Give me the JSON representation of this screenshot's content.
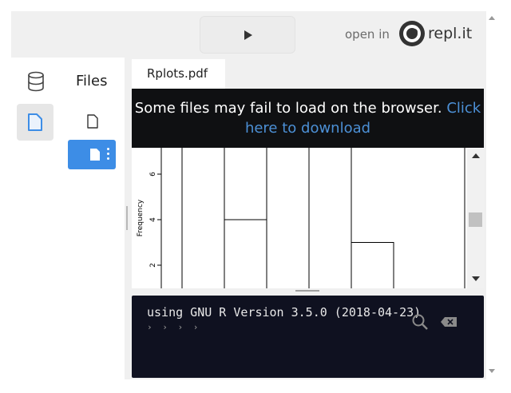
{
  "header": {
    "open_in_label": "open in",
    "brand_text": "repl.it"
  },
  "sidebar": {
    "title": "Files",
    "database_icon": "database-icon",
    "files_icon": "file-icon"
  },
  "tabs": [
    {
      "label": "Rplots.pdf"
    }
  ],
  "viewer": {
    "banner_text": "Some files may fail to load on the browser.",
    "banner_link_part1": "Click",
    "banner_link_part2": "here to download",
    "plot": {
      "ylabel": "Frequency",
      "y_ticks": [
        "6",
        "4",
        "2"
      ]
    }
  },
  "chart_data": {
    "type": "bar",
    "ylabel": "Frequency",
    "y_ticks": [
      2,
      4,
      6
    ],
    "values": [
      8,
      4,
      8,
      8,
      3
    ],
    "note_visible": "partial histogram, top cropped"
  },
  "console": {
    "output_line": "using GNU R Version 3.5.0 (2018-04-23)",
    "prompt": "› › › ›"
  },
  "colors": {
    "accent": "#3d8de6",
    "link": "#4c90d6",
    "console_bg": "#0f1120",
    "banner_bg": "#0f1012"
  }
}
